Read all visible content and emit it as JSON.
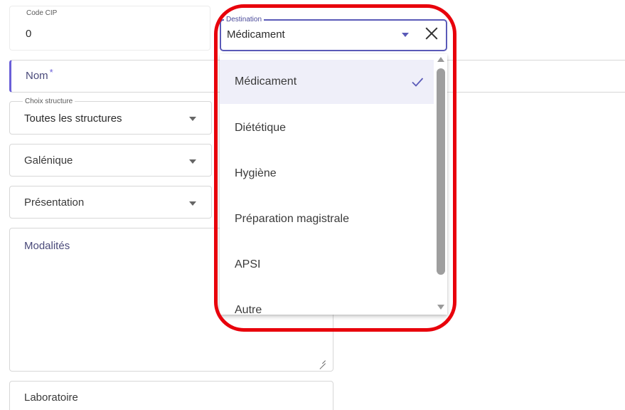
{
  "form": {
    "code_cip": {
      "label": "Code CIP",
      "value": "0"
    },
    "nom": {
      "placeholder": "Nom",
      "required_mark": "*"
    },
    "choix_structure": {
      "label": "Choix structure",
      "value": "Toutes les structures"
    },
    "galenique": {
      "placeholder": "Galénique"
    },
    "presentation": {
      "placeholder": "Présentation"
    },
    "modalites": {
      "placeholder": "Modalités"
    },
    "laboratoire": {
      "placeholder": "Laboratoire"
    }
  },
  "destination": {
    "label": "Destination",
    "value": "Médicament",
    "options": [
      {
        "label": "Médicament",
        "selected": true
      },
      {
        "label": "Diététique",
        "selected": false
      },
      {
        "label": "Hygiène",
        "selected": false
      },
      {
        "label": "Préparation magistrale",
        "selected": false
      },
      {
        "label": "APSI",
        "selected": false
      },
      {
        "label": "Autre",
        "selected": false
      }
    ]
  },
  "colors": {
    "accent": "#5a5ab8",
    "highlight": "#e8000b",
    "selected_bg": "#efeff9"
  }
}
